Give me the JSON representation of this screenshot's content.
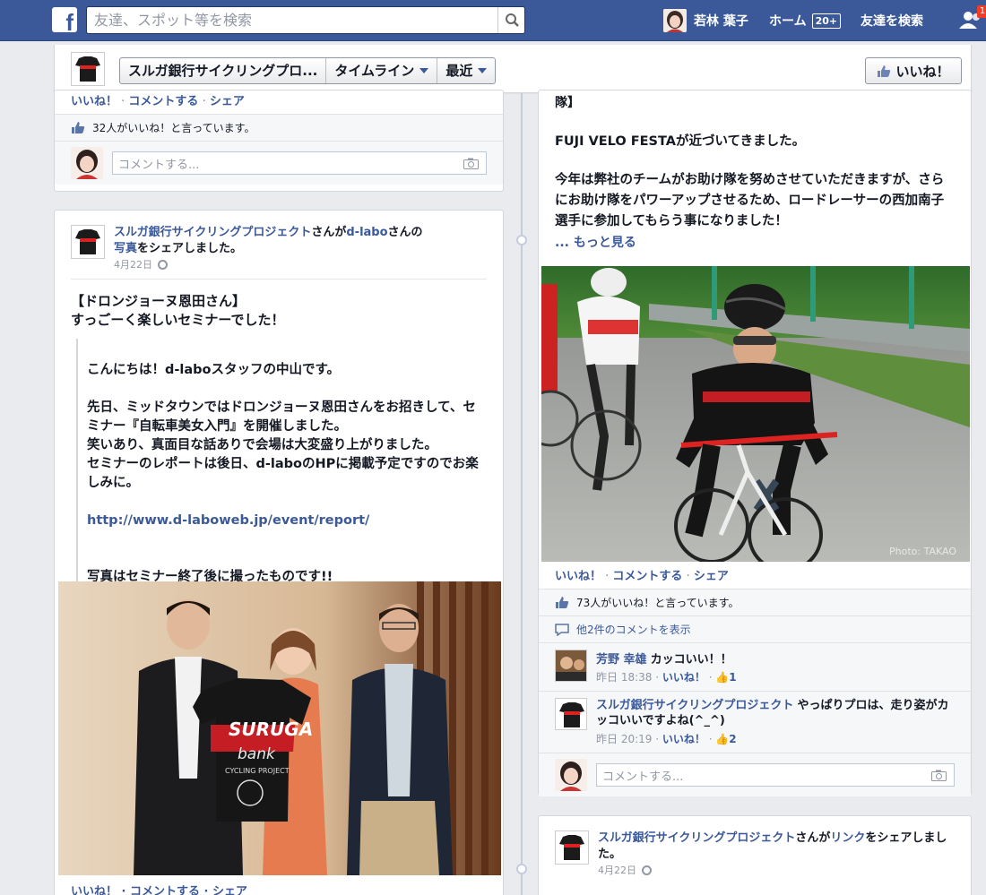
{
  "topbar": {
    "logo": "f",
    "search_placeholder": "友達、スポット等を検索",
    "user_name": "若林 葉子",
    "home_label": "ホーム",
    "home_badge": "20+",
    "find_friends": "友達を検索",
    "friend_requests_badge": "1",
    "brand_color": "#3b5998"
  },
  "subbar": {
    "page_name": "スルガ銀行サイクリングプロ...",
    "timeline": "タイムライン",
    "recent": "最近",
    "like_button": "いいね！"
  },
  "post_top_left": {
    "actions": {
      "like": "いいね！",
      "comment": "コメントする",
      "share": "シェア"
    },
    "likes_text": "32人がいいね！と言っています。",
    "comment_placeholder": "コメントする..."
  },
  "post_left": {
    "author": "スルガ銀行サイクリングプロジェクト",
    "verb1": "さんが",
    "target": "d-labo",
    "verb2": "さんの",
    "object": "写真",
    "verb3": "をシェアしました。",
    "date": "4月22日",
    "text": "【ドロンジョーヌ恩田さん】\nすっごーく楽しいセミナーでした！",
    "quote_text": "こんにちは！d-laboスタッフの中山です。\n\n先日、ミッドタウンではドロンジョーヌ恩田さんをお招きして、セミナー『自転車美女入門』を開催しました。\n笑いあり、真面目な話ありで会場は大変盛り上がりました。\nセミナーのレポートは後日、d-laboのHPに掲載予定ですのでお楽しみに。",
    "quote_link": "http://www.d-laboweb.jp/event/report/",
    "quote_tail": "写真はセミナー終了後に撮ったものです!!",
    "bottom_actions": "いいね！ · コメントする · シェア",
    "jersey_text": "SURUGA",
    "jersey_text2": "bank",
    "jersey_text3": "CYCLING PROJECT"
  },
  "post_right": {
    "title_tail": "隊】",
    "text1": "FUJI VELO FESTAが近づいてきました。",
    "text2": "今年は弊社のチームがお助け隊を努めさせていただきますが、さらにお助け隊をパワーアップさせるため、ロードレーサーの西加南子選手に参加してもらう事になりました！",
    "more": "... もっと見る",
    "photo_credit": "Photo: TAKAO",
    "actions": {
      "like": "いいね！",
      "comment": "コメントする",
      "share": "シェア"
    },
    "likes_text": "73人がいいね！と言っています。",
    "view_more_comments": "他2件のコメントを表示",
    "comments": [
      {
        "name": "芳野 幸雄",
        "text": "カッコいい！！",
        "time": "昨日 18:38",
        "like": "いいね！",
        "count": "1"
      },
      {
        "name": "スルガ銀行サイクリングプロジェクト",
        "text": "やっぱりプロは、走り姿がカッコいいですよね(^_^)",
        "time": "昨日 20:19",
        "like": "いいね！",
        "count": "2"
      }
    ],
    "comment_placeholder": "コメントする..."
  },
  "post_bottom_right": {
    "author": "スルガ銀行サイクリングプロジェクト",
    "verb1": "さんが",
    "object": "リンク",
    "verb2": "をシェアしました。",
    "date": "4月22日"
  }
}
